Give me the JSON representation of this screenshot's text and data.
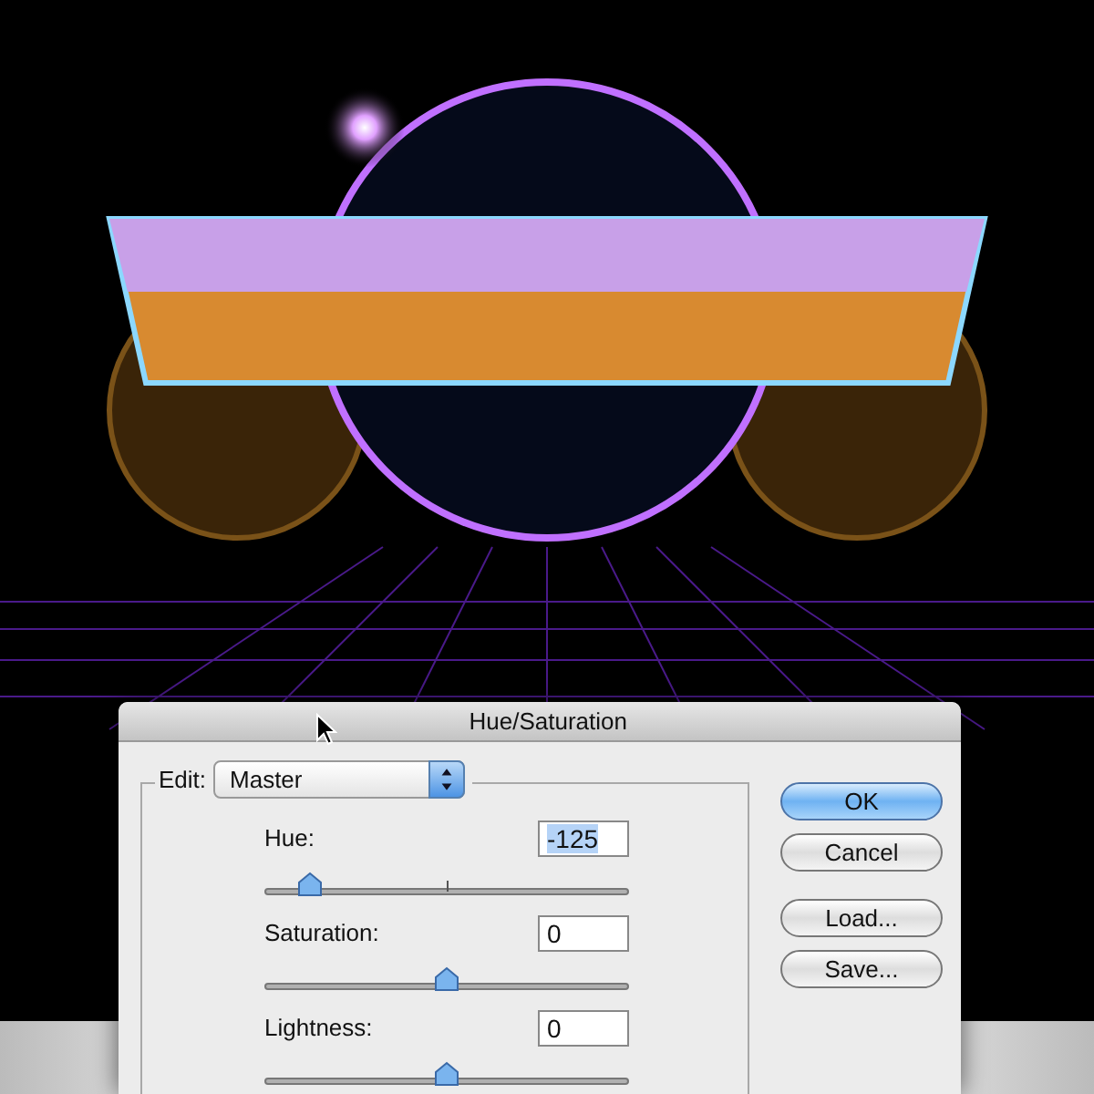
{
  "dialog": {
    "title": "Hue/Saturation",
    "edit": {
      "label": "Edit:",
      "value": "Master"
    },
    "adjustments": [
      {
        "label": "Hue:",
        "value": "-125",
        "value_selected": true,
        "level": 0.12,
        "center_tick": true
      },
      {
        "label": "Saturation:",
        "value": "0",
        "value_selected": false,
        "level": 0.5
      },
      {
        "label": "Lightness:",
        "value": "0",
        "value_selected": false,
        "level": 0.5
      }
    ],
    "buttons": [
      {
        "label": "OK",
        "default": true
      },
      {
        "label": "Cancel",
        "default": false
      },
      {
        "label": "Load...",
        "default": false
      },
      {
        "label": "Save...",
        "default": false
      }
    ]
  }
}
